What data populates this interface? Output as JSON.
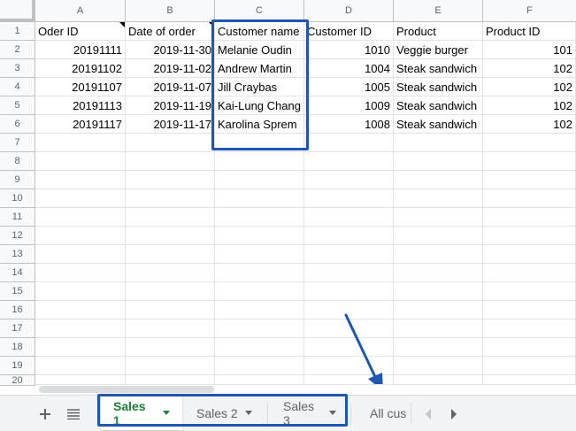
{
  "columns": [
    "A",
    "B",
    "C",
    "D",
    "E",
    "F"
  ],
  "row_numbers": [
    "1",
    "2",
    "3",
    "4",
    "5",
    "6",
    "7",
    "8",
    "9",
    "10",
    "11",
    "12",
    "13",
    "14",
    "15",
    "16",
    "17",
    "18",
    "19",
    "20"
  ],
  "header_cells": [
    "Oder ID",
    "Date of order",
    "Customer name",
    "Customer ID",
    "Product",
    "Product ID"
  ],
  "rows": [
    [
      "20191111",
      "2019-11-30",
      "Melanie Oudin",
      "1010",
      "Veggie burger",
      "101"
    ],
    [
      "20191102",
      "2019-11-02",
      "Andrew Martin",
      "1004",
      "Steak sandwich",
      "102"
    ],
    [
      "20191107",
      "2019-11-07",
      "Jill Craybas",
      "1005",
      "Steak sandwich",
      "102"
    ],
    [
      "20191113",
      "2019-11-19",
      "Kai-Lung Chang",
      "1009",
      "Steak sandwich",
      "102"
    ],
    [
      "20191117",
      "2019-11-17",
      "Karolina Sprem",
      "1008",
      "Steak sandwich",
      "102"
    ]
  ],
  "tabs": {
    "add_icon": "plus-icon",
    "list_icon": "list-icon",
    "sheets": [
      {
        "label": "Sales 1",
        "active": true
      },
      {
        "label": "Sales 2",
        "active": false
      },
      {
        "label": "Sales 3",
        "active": false
      },
      {
        "label": "All cus",
        "active": false
      }
    ],
    "prev_icon": "chevron-left-icon",
    "next_icon": "chevron-right-icon"
  },
  "colors": {
    "highlight": "#1e56b5",
    "active_tab_text": "#188038",
    "header_bg": "#f8f9fa"
  }
}
